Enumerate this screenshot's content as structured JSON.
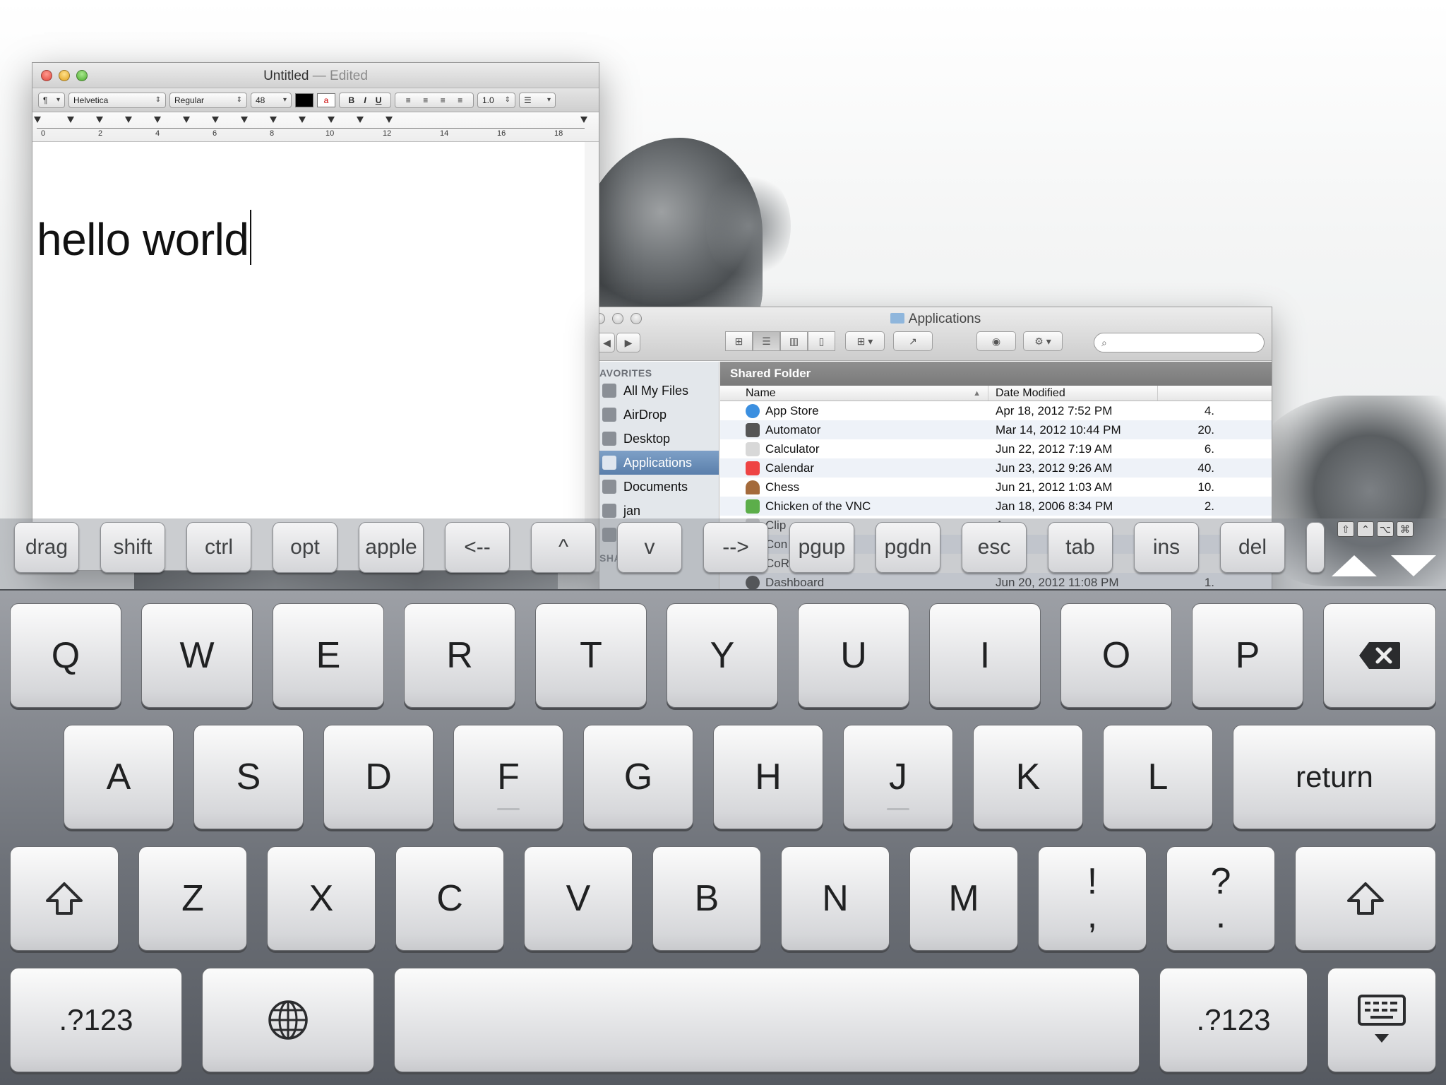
{
  "textedit": {
    "title": "Untitled",
    "title_suffix": "— Edited",
    "toolbar": {
      "paragraph": "¶",
      "font_family": "Helvetica",
      "font_style": "Regular",
      "font_size": "48",
      "color_label": "a",
      "bold": "B",
      "italic": "I",
      "underline": "U",
      "line_spacing": "1.0",
      "list": "☰"
    },
    "ruler": [
      "0",
      "2",
      "4",
      "6",
      "8",
      "10",
      "12",
      "14",
      "16",
      "18"
    ],
    "document_text": "hello world"
  },
  "finder": {
    "title": "Applications",
    "search_placeholder": "",
    "sidebar": {
      "favorites_header": "AVORITES",
      "items": [
        "All My Files",
        "AirDrop",
        "Desktop",
        "Applications",
        "Documents",
        "jan"
      ],
      "shared_header": "SHAR"
    },
    "shared_folder_label": "Shared Folder",
    "columns": {
      "name": "Name",
      "date": "Date Modified"
    },
    "rows": [
      {
        "name": "App Store",
        "date": "Apr 18, 2012 7:52 PM",
        "size": "4."
      },
      {
        "name": "Automator",
        "date": "Mar 14, 2012 10:44 PM",
        "size": "20."
      },
      {
        "name": "Calculator",
        "date": "Jun 22, 2012 7:19 AM",
        "size": "6."
      },
      {
        "name": "Calendar",
        "date": "Jun 23, 2012 9:26 AM",
        "size": "40."
      },
      {
        "name": "Chess",
        "date": "Jun 21, 2012 1:03 AM",
        "size": "10."
      },
      {
        "name": "Chicken of the VNC",
        "date": "Jan 18, 2006 8:34 PM",
        "size": "2."
      },
      {
        "name": "Clip",
        "date": "Ap",
        "size": ""
      },
      {
        "name": "Con",
        "date": "Ma",
        "size": ""
      },
      {
        "name": "CoR",
        "date": "Ma",
        "size": ""
      },
      {
        "name": "Dashboard",
        "date": "Jun 20, 2012 11:08 PM",
        "size": "1."
      }
    ]
  },
  "extra_keys": [
    "drag",
    "shift",
    "ctrl",
    "opt",
    "apple",
    "<--",
    "^",
    "v",
    "-->",
    "pgup",
    "pgdn",
    "esc",
    "tab",
    "ins",
    "del"
  ],
  "mini_mods": [
    "⇧",
    "⌃",
    "⌥",
    "⌘"
  ],
  "keyboard": {
    "row1": [
      "Q",
      "W",
      "E",
      "R",
      "T",
      "Y",
      "U",
      "I",
      "O",
      "P"
    ],
    "row2": [
      "A",
      "S",
      "D",
      "F",
      "G",
      "H",
      "J",
      "K",
      "L"
    ],
    "row3": [
      "Z",
      "X",
      "C",
      "V",
      "B",
      "N",
      "M"
    ],
    "return_label": "return",
    "num_label": ".?123",
    "excl_top": "!",
    "excl_bottom": ",",
    "quest_top": "?",
    "quest_bottom": "."
  }
}
